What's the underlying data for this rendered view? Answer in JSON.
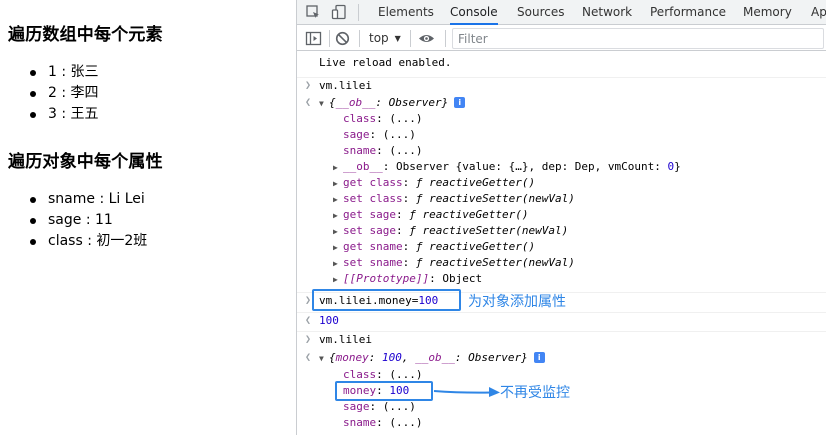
{
  "page": {
    "heading_array": "遍历数组中每个元素",
    "array_items": [
      "1 : 张三",
      "2 : 李四",
      "3 : 王五"
    ],
    "heading_object": "遍历对象中每个属性",
    "object_items": [
      "sname : Li Lei",
      "sage : 11",
      "class : 初一2班"
    ]
  },
  "devtools": {
    "tabs": [
      "Elements",
      "Console",
      "Sources",
      "Network",
      "Performance",
      "Memory",
      "Ap"
    ],
    "active_tab": "Console",
    "context_select": "top",
    "filter_placeholder": "Filter",
    "accent_color": "#1a73e8",
    "annotation_color": "#2f86e6"
  },
  "console": {
    "live_reload": "Live reload enabled.",
    "cmd1": "vm.lilei",
    "obj1_summary_key": "__ob__",
    "obj1_summary_val": "Observer",
    "obj1_props": [
      {
        "key": "class",
        "val": "(...)"
      },
      {
        "key": "sage",
        "val": "(...)"
      },
      {
        "key": "sname",
        "val": "(...)"
      }
    ],
    "ob_line": {
      "key": "__ob__",
      "value_prefix": "Observer {value: {…}, dep: Dep, vmCount: ",
      "vmcount": "0",
      "suffix": "}"
    },
    "accessors": [
      {
        "kind": "get",
        "prop": "class",
        "fn": "reactiveGetter",
        "args": ""
      },
      {
        "kind": "set",
        "prop": "class",
        "fn": "reactiveSetter",
        "args": "newVal"
      },
      {
        "kind": "get",
        "prop": "sage",
        "fn": "reactiveGetter",
        "args": ""
      },
      {
        "kind": "set",
        "prop": "sage",
        "fn": "reactiveSetter",
        "args": "newVal"
      },
      {
        "kind": "get",
        "prop": "sname",
        "fn": "reactiveGetter",
        "args": ""
      },
      {
        "kind": "set",
        "prop": "sname",
        "fn": "reactiveSetter",
        "args": "newVal"
      }
    ],
    "prototype_key": "[[Prototype]]",
    "prototype_val": "Object",
    "cmd2_prefix": "vm.lilei.money=",
    "cmd2_value": "100",
    "annotation_add": "为对象添加属性",
    "result2": "100",
    "cmd3": "vm.lilei",
    "obj2_summary": {
      "k1": "money",
      "v1": "100",
      "k2": "__ob__",
      "v2": "Observer"
    },
    "obj2_props": [
      {
        "key": "class",
        "val": "(...)"
      },
      {
        "key": "money",
        "val": "100"
      },
      {
        "key": "sage",
        "val": "(...)"
      },
      {
        "key": "sname",
        "val": "(...)"
      }
    ],
    "annotation_no_monitor": "不再受监控",
    "f_glyph": "ƒ"
  }
}
